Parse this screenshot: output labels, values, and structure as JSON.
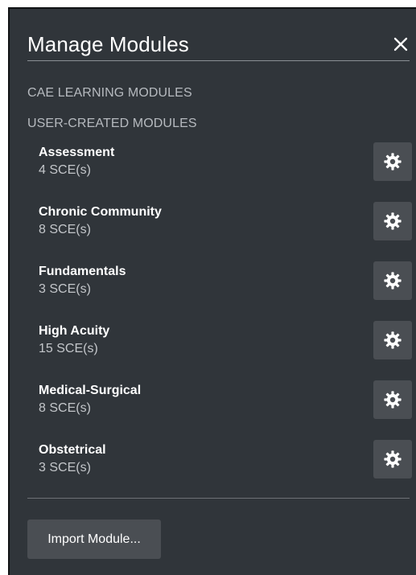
{
  "header": {
    "title": "Manage Modules",
    "close_icon": "close-icon"
  },
  "sections": {
    "cae": "CAE LEARNING MODULES",
    "user": "USER-CREATED MODULES"
  },
  "modules": [
    {
      "name": "Assessment",
      "count": "4 SCE(s)",
      "icon": "gear-icon"
    },
    {
      "name": "Chronic Community",
      "count": "8 SCE(s)",
      "icon": "gear-icon"
    },
    {
      "name": "Fundamentals",
      "count": "3 SCE(s)",
      "icon": "gear-icon"
    },
    {
      "name": "High Acuity",
      "count": "15 SCE(s)",
      "icon": "gear-icon"
    },
    {
      "name": "Medical-Surgical",
      "count": "8 SCE(s)",
      "icon": "gear-icon"
    },
    {
      "name": "Obstetrical",
      "count": "3 SCE(s)",
      "icon": "gear-icon"
    }
  ],
  "footer": {
    "import_label": "Import Module..."
  },
  "colors": {
    "panel_background": "#30353a",
    "button_background": "#4a4e53",
    "primary_text": "#ffffff",
    "secondary_text": "#c3c6ca"
  }
}
